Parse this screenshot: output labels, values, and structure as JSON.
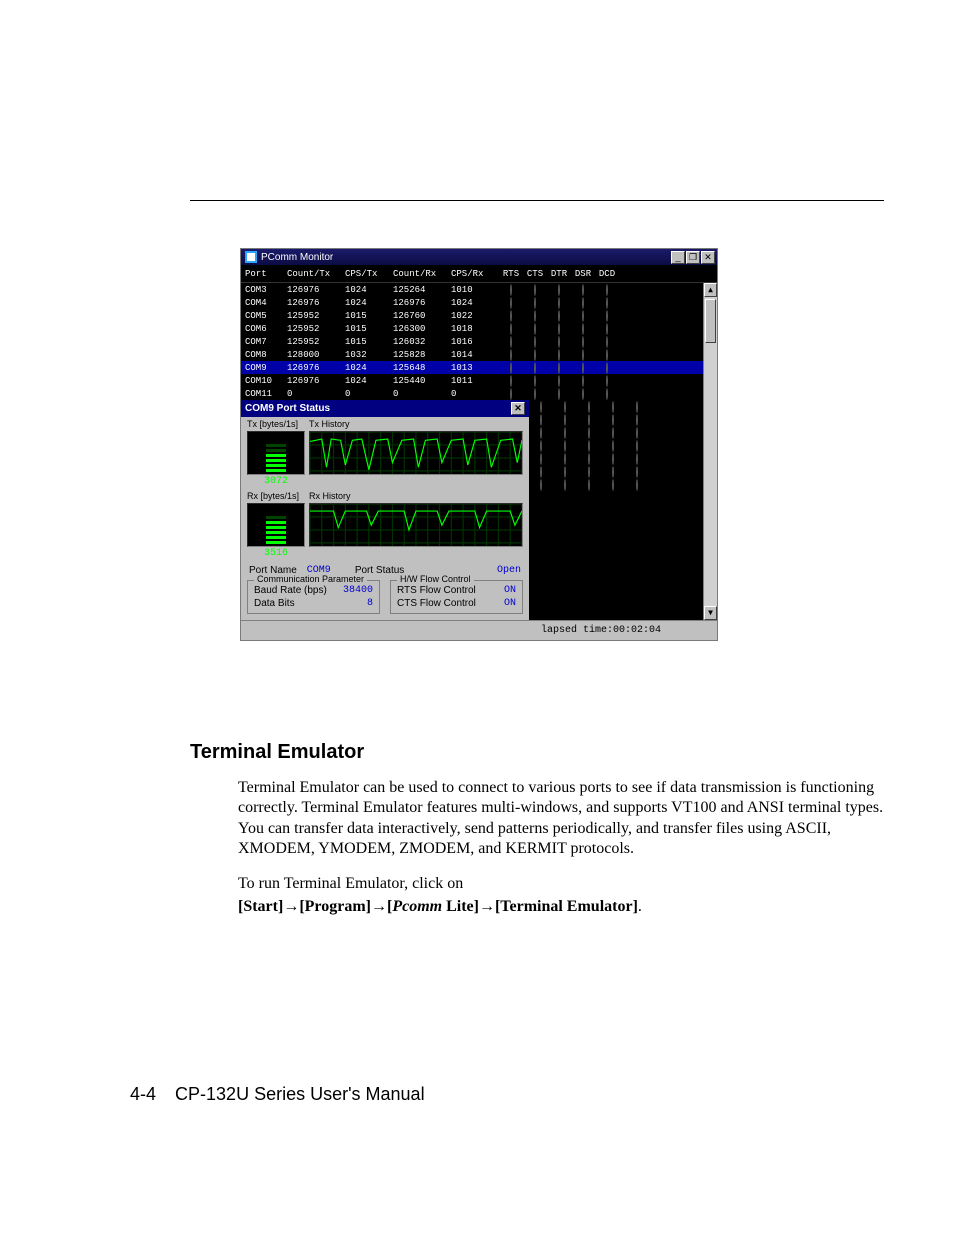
{
  "window": {
    "title": "PComm Monitor",
    "min": "_",
    "restore": "❐",
    "close": "✕"
  },
  "columns": [
    "Port",
    "Count/Tx",
    "CPS/Tx",
    "Count/Rx",
    "CPS/Rx",
    "RTS",
    "CTS",
    "DTR",
    "DSR",
    "DCD"
  ],
  "rows": [
    {
      "port": "COM3",
      "ctx": "126976",
      "cpstx": "1024",
      "crx": "125264",
      "cpsrx": "1010",
      "lamps": [
        "on",
        "on",
        "off",
        "off",
        "on"
      ],
      "sel": false
    },
    {
      "port": "COM4",
      "ctx": "126976",
      "cpstx": "1024",
      "crx": "126976",
      "cpsrx": "1024",
      "lamps": [
        "on",
        "on",
        "off",
        "off",
        "on"
      ],
      "sel": false
    },
    {
      "port": "COM5",
      "ctx": "125952",
      "cpstx": "1015",
      "crx": "126760",
      "cpsrx": "1022",
      "lamps": [
        "on",
        "on",
        "off",
        "off",
        "on"
      ],
      "sel": false
    },
    {
      "port": "COM6",
      "ctx": "125952",
      "cpstx": "1015",
      "crx": "126300",
      "cpsrx": "1018",
      "lamps": [
        "on",
        "on",
        "off",
        "off",
        "on"
      ],
      "sel": false
    },
    {
      "port": "COM7",
      "ctx": "125952",
      "cpstx": "1015",
      "crx": "126032",
      "cpsrx": "1016",
      "lamps": [
        "on",
        "on",
        "off",
        "off",
        "on"
      ],
      "sel": false
    },
    {
      "port": "COM8",
      "ctx": "128000",
      "cpstx": "1032",
      "crx": "125828",
      "cpsrx": "1014",
      "lamps": [
        "on",
        "on",
        "off",
        "off",
        "on"
      ],
      "sel": false
    },
    {
      "port": "COM9",
      "ctx": "126976",
      "cpstx": "1024",
      "crx": "125648",
      "cpsrx": "1013",
      "lamps": [
        "dim",
        "dim",
        "off",
        "off",
        "dim"
      ],
      "sel": true
    },
    {
      "port": "COM10",
      "ctx": "126976",
      "cpstx": "1024",
      "crx": "125440",
      "cpsrx": "1011",
      "lamps": [
        "on",
        "on",
        "off",
        "off",
        "on"
      ],
      "sel": false
    },
    {
      "port": "COM11",
      "ctx": "0",
      "cpstx": "0",
      "crx": "0",
      "cpsrx": "0",
      "lamps": [
        "on",
        "off",
        "on",
        "off",
        "on"
      ],
      "sel": false
    }
  ],
  "extra_lamp_rows": [
    [
      "on",
      "off",
      "on",
      "off",
      "on"
    ],
    [
      "on",
      "off",
      "on",
      "off",
      "on"
    ],
    [
      "on",
      "off",
      "on",
      "off",
      "on"
    ],
    [
      "on",
      "off",
      "on",
      "off",
      "on"
    ],
    [
      "on",
      "off",
      "on",
      "off",
      "on"
    ],
    [
      "on",
      "off",
      "on",
      "off",
      "on"
    ],
    [
      "on",
      "off",
      "on",
      "off",
      "on"
    ]
  ],
  "panel": {
    "title": "COM9 Port Status",
    "close": "✕",
    "tx_label": "Tx [bytes/1s]",
    "tx_hist_label": "Tx History",
    "tx_value": "3072",
    "rx_label": "Rx [bytes/1s]",
    "rx_hist_label": "Rx History",
    "rx_value": "3516",
    "portname_label": "Port Name",
    "portname_value": "COM9",
    "portstatus_label": "Port Status",
    "portstatus_value": "Open",
    "comm_legend": "Communication Parameter",
    "hw_legend": "H/W Flow Control",
    "baud_label": "Baud Rate (bps)",
    "baud_value": "38400",
    "databits_label": "Data Bits",
    "databits_value": "8",
    "rts_label": "RTS Flow Control",
    "rts_value": "ON",
    "cts_label": "CTS Flow Control",
    "cts_value": "ON"
  },
  "statusbar": "lapsed time:00:02:04",
  "section": {
    "heading": "Terminal Emulator",
    "para": "Terminal Emulator can be used to connect to various ports to see if data transmission is functioning correctly. Terminal Emulator features multi-windows, and supports VT100 and ANSI terminal types. You can transfer data interactively, send patterns periodically, and transfer files using ASCII, XMODEM, YMODEM, ZMODEM, and KERMIT protocols.",
    "para2": "To run Terminal Emulator, click on",
    "nav_start": "[Start]",
    "nav_program": "[Program]",
    "nav_open": "[",
    "nav_pcomm": "Pcomm",
    "nav_lite": " Lite]",
    "nav_term": "[Terminal Emulator]",
    "nav_dot": "."
  },
  "footer": {
    "pagenum": "4-4",
    "manual": "CP-132U Series User's Manual"
  },
  "glyphs": {
    "arrow": "→",
    "up": "▲",
    "down": "▼"
  }
}
